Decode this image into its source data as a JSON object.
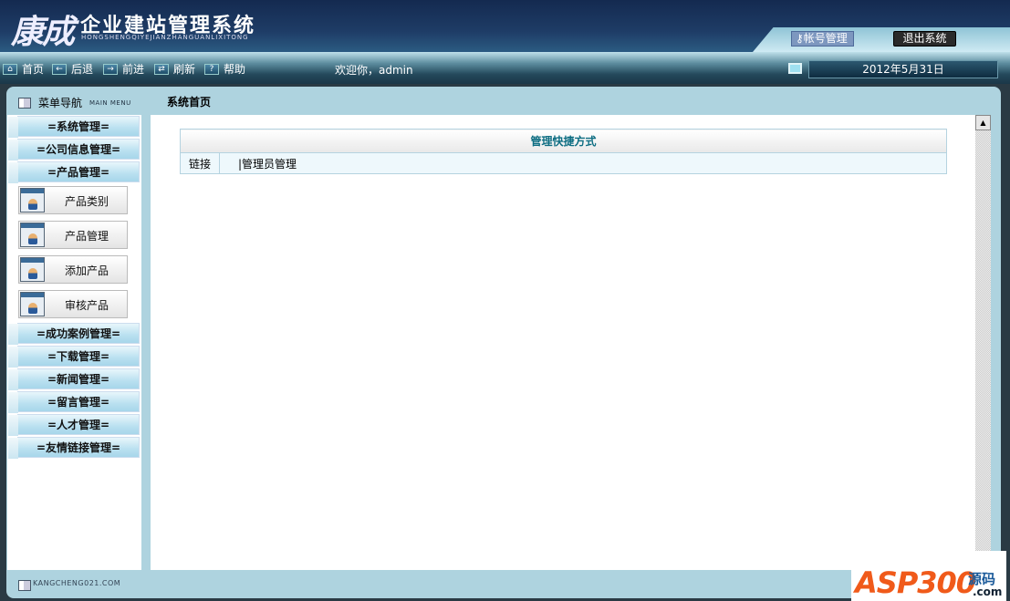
{
  "header": {
    "logo_main": "康成",
    "title": "企业建站管理系统",
    "subtitle": "HONGSHENGQIYEJIANZHANGUANLIXITONG",
    "account_button": "帐号管理",
    "logout_button": "退出系统"
  },
  "toolbar": {
    "home": "首页",
    "back": "后退",
    "forward": "前进",
    "refresh": "刷新",
    "help": "帮助",
    "welcome": "欢迎你，admin",
    "date": "2012年5月31日"
  },
  "sidebar": {
    "title": "菜单导航",
    "title_en": "MAIN MENU",
    "top_groups": [
      "=系统管理=",
      "=公司信息管理=",
      "=产品管理="
    ],
    "items": [
      "产品类别",
      "产品管理",
      "添加产品",
      "审核产品"
    ],
    "bottom_groups": [
      "=成功案例管理=",
      "=下载管理=",
      "=新闻管理=",
      "=留言管理=",
      "=人才管理=",
      "=友情链接管理="
    ]
  },
  "breadcrumb": "系统首页",
  "shortcuts": {
    "title": "管理快捷方式",
    "label": "链接",
    "value": "|管理员管理"
  },
  "footer": {
    "site": "KANGCHENG021.COM",
    "watermark_main": "ASP300",
    "watermark_cn": "源码",
    "watermark_dom": ".com"
  }
}
